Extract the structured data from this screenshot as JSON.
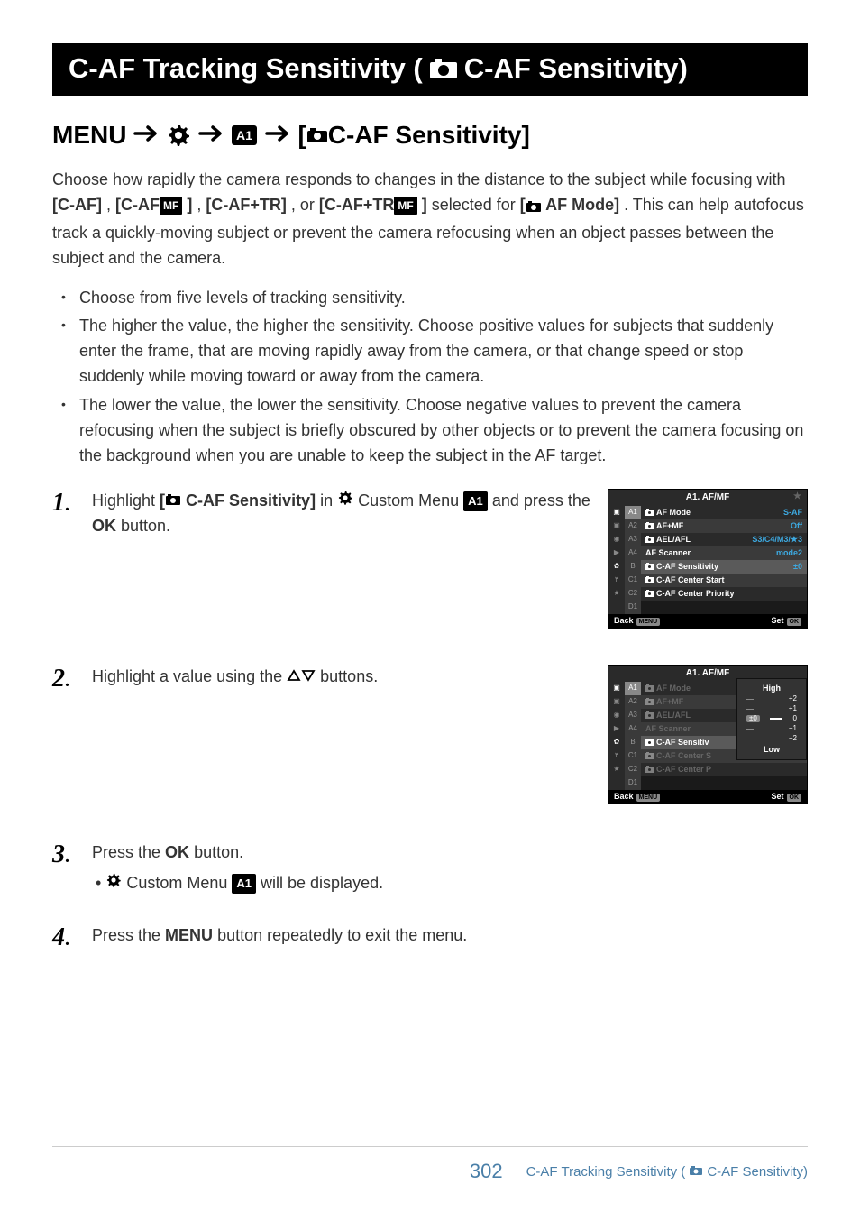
{
  "title": {
    "prefix": "C-AF Tracking Sensitivity (",
    "suffix": " C-AF Sensitivity)"
  },
  "subtitle": {
    "menu_label": "MENU",
    "bracket_open": " [",
    "item": " C-AF Sensitivity]"
  },
  "intro": {
    "seg1": "Choose how rapidly the camera responds to changes in the distance to the subject while focusing with ",
    "seg2_bold": "[C-AF]",
    "seg3": ", ",
    "seg4_bold": "[C-AF",
    "seg5_bold_suffix": " ]",
    "seg6": ", ",
    "seg7_bold": "[C-AF+TR]",
    "seg8": ", or ",
    "seg9_bold": "[C-AF+TR",
    "seg10_bold_suffix": " ]",
    "seg11": " selected for ",
    "seg12_bold": "[",
    "seg13_bold": " AF Mode]",
    "seg14": ". This can help autofocus track a quickly-moving subject or prevent the camera refocusing when an object passes between the subject and the camera."
  },
  "bullets": [
    "Choose from five levels of tracking sensitivity.",
    "The higher the value, the higher the sensitivity. Choose positive values for subjects that suddenly enter the frame, that are moving rapidly away from the camera, or that change speed or stop suddenly while moving toward or away from the camera.",
    "The lower the value, the lower the sensitivity. Choose negative values to prevent the camera refocusing when the subject is briefly obscured by other objects or to prevent the camera focusing on the background when you are unable to keep the subject in the AF target."
  ],
  "steps": {
    "s1": {
      "num": "1",
      "seg1": "Highlight ",
      "seg2_bold": "[",
      "seg3_bold": " C-AF Sensitivity]",
      "seg4": " in ",
      "seg5": " Custom Menu ",
      "seg6": " and press the ",
      "seg7_bold": "OK",
      "seg8": " button."
    },
    "s2": {
      "num": "2",
      "seg1": "Highlight a value using the ",
      "seg2": " buttons."
    },
    "s3": {
      "num": "3",
      "seg1": "Press the ",
      "seg2_bold": "OK",
      "seg3": " button.",
      "sub_seg1": " Custom Menu ",
      "sub_seg2": " will be displayed."
    },
    "s4": {
      "num": "4",
      "seg1": "Press the ",
      "seg2_bold": "MENU",
      "seg3": " button repeatedly to exit the menu."
    }
  },
  "screenshot1": {
    "header": "A1. AF/MF",
    "subtabs": [
      "A1",
      "A2",
      "A3",
      "A4",
      "B",
      "C1",
      "C2",
      "D1"
    ],
    "rows": [
      {
        "label": "AF Mode",
        "val": "S-AF",
        "cam": true
      },
      {
        "label": "AF+MF",
        "val": "Off",
        "cam": true
      },
      {
        "label": "AEL/AFL",
        "val": "S3/C4/M3/★3",
        "cam": true
      },
      {
        "label": "AF Scanner",
        "val": "mode2",
        "cam": false
      },
      {
        "label": "C-AF Sensitivity",
        "val": "±0",
        "cam": true,
        "selected": true
      },
      {
        "label": "C-AF Center Start",
        "val": "",
        "cam": true
      },
      {
        "label": "C-AF Center Priority",
        "val": "",
        "cam": true
      }
    ],
    "footer_back": "Back",
    "footer_menu": "MENU",
    "footer_set": "Set",
    "footer_ok": "OK"
  },
  "screenshot2": {
    "header": "A1. AF/MF",
    "subtabs": [
      "A1",
      "A2",
      "A3",
      "A4",
      "B",
      "C1",
      "C2",
      "D1"
    ],
    "rows": [
      {
        "label": "AF Mode",
        "cam": true,
        "dim": true
      },
      {
        "label": "AF+MF",
        "cam": true,
        "dim": true
      },
      {
        "label": "AEL/AFL",
        "cam": true,
        "dim": true
      },
      {
        "label": "AF Scanner",
        "cam": false,
        "dim": true
      },
      {
        "label": "C-AF Sensitiv",
        "cam": true,
        "selected": true
      },
      {
        "label": "C-AF Center S",
        "cam": true,
        "dim": true
      },
      {
        "label": "C-AF Center P",
        "cam": true,
        "dim": true
      }
    ],
    "popup": {
      "high": "High",
      "low": "Low",
      "levels": [
        "+2",
        "+1",
        "0",
        "−1",
        "−2"
      ],
      "selected_prefix": "±0"
    },
    "footer_back": "Back",
    "footer_menu": "MENU",
    "footer_set": "Set",
    "footer_ok": "OK"
  },
  "footer": {
    "page_number": "302",
    "link_text": "C-AF Tracking Sensitivity (",
    "link_suffix": " C-AF Sensitivity)"
  },
  "badges": {
    "mf": "MF",
    "a1": "A1"
  }
}
